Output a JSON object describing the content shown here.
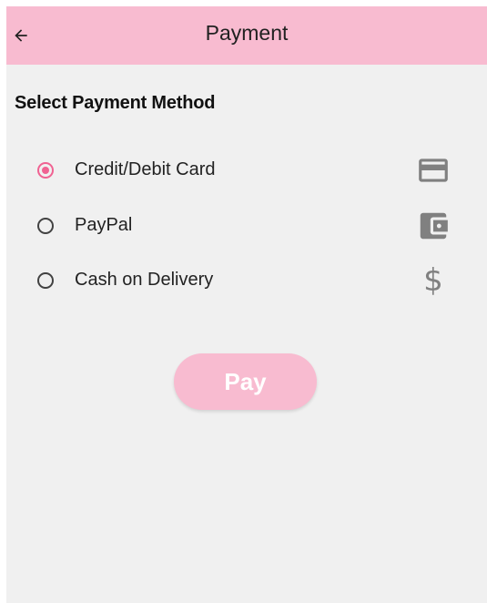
{
  "appbar": {
    "title": "Payment",
    "back_icon": "arrow-left-icon",
    "background": "#f8bbd0"
  },
  "section": {
    "title": "Select Payment Method"
  },
  "payment_methods": [
    {
      "label": "Credit/Debit Card",
      "selected": true,
      "icon": "credit-card-icon"
    },
    {
      "label": "PayPal",
      "selected": false,
      "icon": "wallet-icon"
    },
    {
      "label": "Cash on Delivery",
      "selected": false,
      "icon": "dollar-icon"
    }
  ],
  "icons": {
    "dollar_glyph": "$"
  },
  "pay_button": {
    "label": "Pay",
    "background": "#f8bbd0",
    "text_color": "#ffffff"
  },
  "colors": {
    "accent": "#f06292",
    "screen_background": "#f0f0f0",
    "icon_gray": "#808080"
  }
}
